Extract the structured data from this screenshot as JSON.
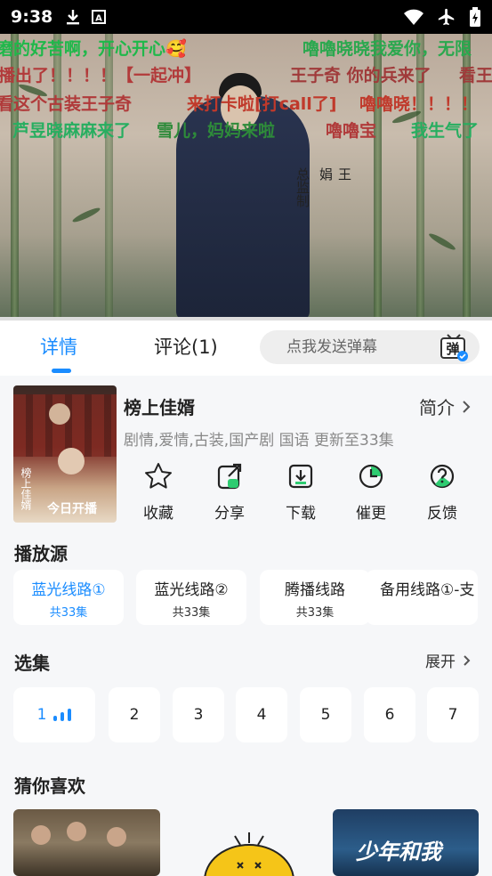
{
  "status_bar": {
    "time": "9:38",
    "icons": [
      "download-icon",
      "text-icon",
      "wifi-icon",
      "airplane-icon",
      "battery-icon"
    ]
  },
  "video": {
    "signature": [
      "王",
      "娟"
    ],
    "signature_small": "总监制",
    "danmaku": [
      {
        "text": "磨的好苦啊，开心开心🥰",
        "color": "#1fb84a"
      },
      {
        "text": "嚕嚕晓晓我爱你，无限",
        "color": "#2aa84e"
      },
      {
        "text": "播出了！！！！【一起冲】",
        "color": "#b23a3a"
      },
      {
        "text": "王子奇 你的兵来了",
        "color": "#a03a3a"
      },
      {
        "text": "看王",
        "color": "#a03a3a"
      },
      {
        "text": "看这个古装王子奇",
        "color": "#b03a3a"
      },
      {
        "text": "来打卡啦[打call了]",
        "color": "#c0392b"
      },
      {
        "text": "嚕嚕晓！！！！",
        "color": "#c0392b"
      },
      {
        "text": "芦昱晓麻麻来了",
        "color": "#27ae60"
      },
      {
        "text": "雪儿，妈妈来啦",
        "color": "#2e8b3a"
      },
      {
        "text": "嚕嚕宝",
        "color": "#b03a3a"
      },
      {
        "text": "我生气了",
        "color": "#27ae60"
      }
    ]
  },
  "tabs": [
    {
      "label": "详情",
      "active": true
    },
    {
      "label": "评论(1)",
      "active": false
    }
  ],
  "danmu_input": {
    "placeholder": "点我发送弹幕",
    "button_glyph": "弹"
  },
  "show": {
    "title": "榜上佳婿",
    "intro_label": "简介",
    "tags": "剧情,爱情,古装,国产剧 国语 更新至33集",
    "poster_text": "今日开播",
    "poster_side": "榜上佳婿"
  },
  "actions": [
    {
      "label": "收藏",
      "icon": "star-icon"
    },
    {
      "label": "分享",
      "icon": "share-icon"
    },
    {
      "label": "下载",
      "icon": "download-icon"
    },
    {
      "label": "催更",
      "icon": "clock-icon"
    },
    {
      "label": "反馈",
      "icon": "question-icon"
    }
  ],
  "sources": {
    "title": "播放源",
    "items": [
      {
        "name": "蓝光线路①",
        "count": "共33集",
        "active": true
      },
      {
        "name": "蓝光线路②",
        "count": "共33集",
        "active": false
      },
      {
        "name": "腾播线路",
        "count": "共33集",
        "active": false
      },
      {
        "name": "备用线路①-支",
        "count": "",
        "active": false
      }
    ]
  },
  "episodes": {
    "title": "选集",
    "expand_label": "展开",
    "items": [
      "1",
      "2",
      "3",
      "4",
      "5",
      "6",
      "7"
    ]
  },
  "recommend": {
    "title": "猜你喜欢",
    "item3_text": "少年和我"
  },
  "colors": {
    "accent": "#1a8cff"
  }
}
